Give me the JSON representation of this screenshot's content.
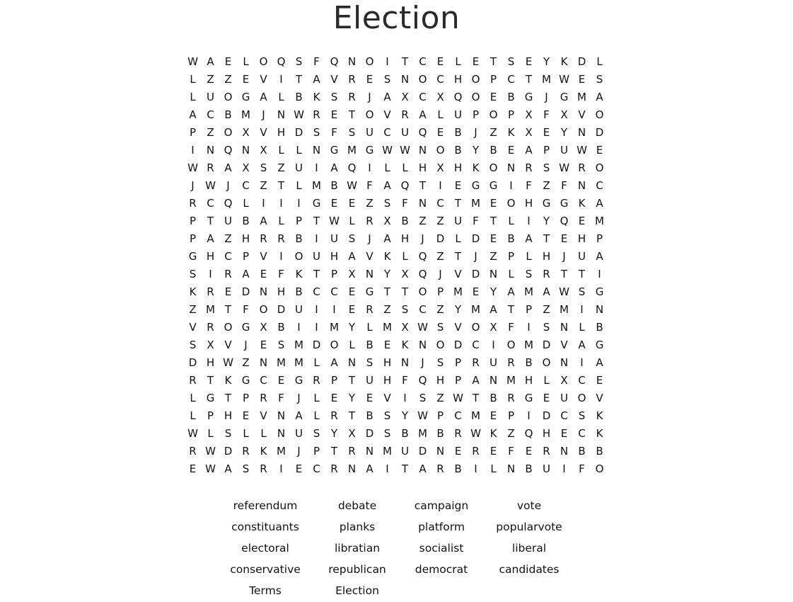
{
  "title": "Election",
  "grid": [
    "WAELOQSFQNOITCELETSEYKDL",
    "LZZEVITAVRESNOCHOPCTMWES",
    "LUOGALBKSRJAXCXQOEBGJGMA",
    "ACBMJNWRETOVRALUPOPXFXVO",
    "PZOXVHDSFSUCUQEBJZKXEYND",
    "INQNXLLNGMGWWNOBYBEAPUWE",
    "WRAXSZUIAQILLHXHKONRSWRO",
    "JWJCZTLMBWFAQTIEGGIFZFNC",
    "RCQLIIIGEEZSFNCTMEOHGGKA",
    "PTUBALPTWLRXBZZUFTLIYQEM",
    "PAZHRRBIUSJAHJDLDEBATEHP",
    "GHCPVIOUHAVKLQZTJZPLHJUA",
    "SIRAEFKTPXNYXQJVDNLSRTTI",
    "KREDNHBCCEGTTOPMEYAMAWSG",
    "ZMTFODUIIERZSCZYMATPZMIN",
    "VROGXBIIMYLMXWSVOXFISNLB",
    "SXVJESMDOLBEKNODCIOMDVAG",
    "DHWZNMMLANSHNJSPRURBONIA",
    "RTKGCEGRPTUHFQHPANMHLXCE",
    "LGTPRFJLEYEVISZWTBRGEUOV",
    "LPHEVNALRTBSYWPCMEPIDCSK",
    "WLSLLNUSYXDSBMBRWKZQHECK",
    "RWDRKMJPTRNMUDNEREFERNBB",
    "EWASRIECRNAITARBILNBUIFO"
  ],
  "word_list": [
    [
      "referendum",
      "debate",
      "campaign",
      "vote"
    ],
    [
      "constituants",
      "planks",
      "platform",
      "popularvote"
    ],
    [
      "electoral",
      "libratian",
      "socialist",
      "liberal"
    ],
    [
      "conservative",
      "republican",
      "democrat",
      "candidates"
    ],
    [
      "Terms",
      "Election"
    ]
  ]
}
